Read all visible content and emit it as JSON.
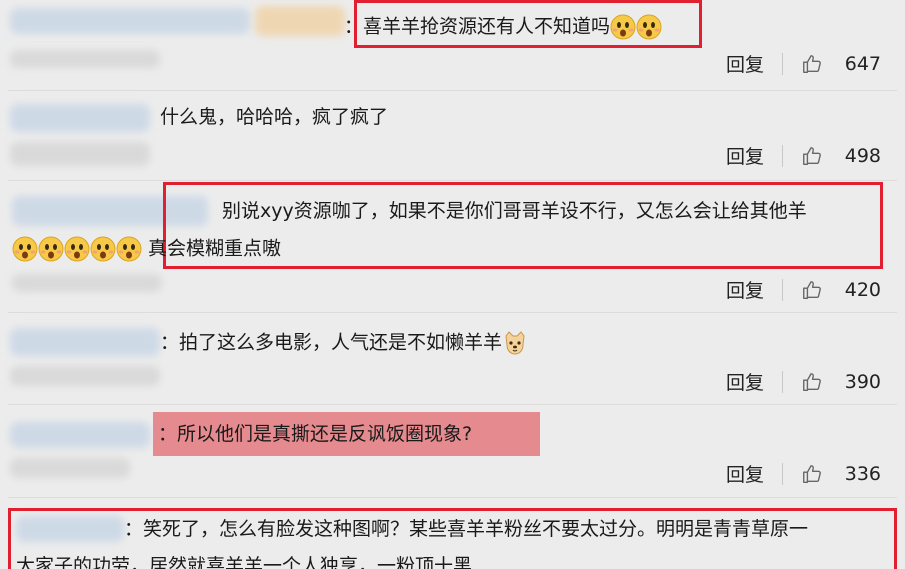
{
  "comments": [
    {
      "text": "：喜羊羊抢资源还有人不知道吗",
      "reply": "回复",
      "likes": "647"
    },
    {
      "text": "什么鬼，哈哈哈，疯了疯了",
      "reply": "回复",
      "likes": "498"
    },
    {
      "text_line1": "别说xyy资源咖了，如果不是你们哥哥羊设不行，又怎么会让给其他羊",
      "text_line2": "真会模糊重点嗷",
      "reply": "回复",
      "likes": "420"
    },
    {
      "text": "：拍了这么多电影，人气还是不如懒羊羊",
      "reply": "回复",
      "likes": "390"
    },
    {
      "text": "：所以他们是真撕还是反讽饭圈现象?",
      "reply": "回复",
      "likes": "336"
    },
    {
      "text_line1": "：笑死了，怎么有脸发这种图啊？某些喜羊羊粉丝不要太过分。明明是青青草原一",
      "text_line2": "大家子的功劳，居然就喜羊羊一个人独享，一粉顶十黑"
    }
  ],
  "colors": {
    "highlight_border": "#e02030",
    "highlight_fill": "#e58a8e"
  },
  "icons": {
    "like": "thumbs-up-icon",
    "emoji_shock": "shocked-face-emoji",
    "emoji_dog": "dog-face-emoji"
  }
}
